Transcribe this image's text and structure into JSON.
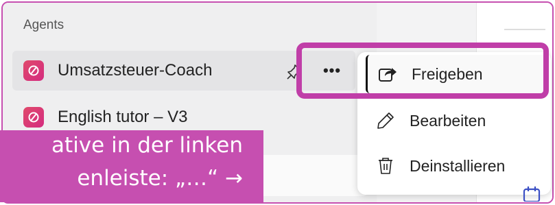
{
  "sidebar": {
    "section_title": "Agents",
    "agents": [
      {
        "name": "Umsatzsteuer-Coach",
        "active": true
      },
      {
        "name": "English tutor – V3",
        "active": false
      }
    ],
    "pin_icon": "pin-icon",
    "more_label": "•••"
  },
  "context_menu": {
    "items": [
      {
        "label": "Freigeben",
        "icon": "share-icon"
      },
      {
        "label": "Bearbeiten",
        "icon": "pencil-icon"
      },
      {
        "label": "Deinstallieren",
        "icon": "trash-icon"
      }
    ]
  },
  "annotation": {
    "line1": "ative in der linken",
    "line2": "enleiste: „…“ →"
  },
  "colors": {
    "highlight": "#c03ea8",
    "callout": "#c64fb0",
    "agent_icon": "#d42c80"
  }
}
